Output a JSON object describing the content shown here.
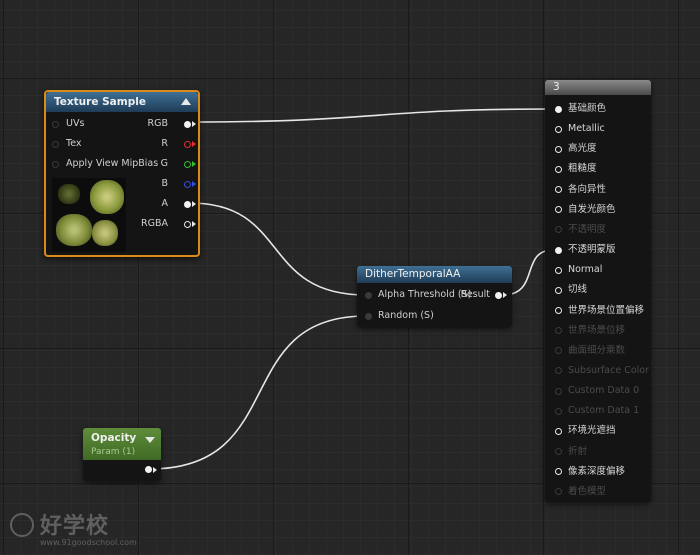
{
  "colors": {
    "node_border_selected": "#d88a1a",
    "pin_red": "#e03030",
    "pin_green": "#30c030",
    "pin_blue": "#3050e0"
  },
  "texture_sample": {
    "title": "Texture Sample",
    "inputs": [
      "UVs",
      "Tex",
      "Apply View MipBias"
    ],
    "outputs": [
      "RGB",
      "R",
      "G",
      "B",
      "A",
      "RGBA"
    ]
  },
  "dither": {
    "title": "DitherTemporalAA",
    "inputs": [
      "Alpha Threshold (S)",
      "Random (S)"
    ],
    "output": "Result"
  },
  "opacity": {
    "title": "Opacity",
    "subtitle": "Param (1)"
  },
  "result": {
    "title": "3",
    "rows": [
      {
        "label": "基础颜色",
        "state": "connected"
      },
      {
        "label": "Metallic",
        "state": "open"
      },
      {
        "label": "高光度",
        "state": "open"
      },
      {
        "label": "粗糙度",
        "state": "open"
      },
      {
        "label": "各向异性",
        "state": "open"
      },
      {
        "label": "自发光颜色",
        "state": "open"
      },
      {
        "label": "不透明度",
        "state": "disabled"
      },
      {
        "label": "不透明蒙版",
        "state": "connected"
      },
      {
        "label": "Normal",
        "state": "open"
      },
      {
        "label": "切线",
        "state": "open"
      },
      {
        "label": "世界场景位置偏移",
        "state": "open"
      },
      {
        "label": "世界场景位移",
        "state": "disabled"
      },
      {
        "label": "曲面细分乘数",
        "state": "disabled"
      },
      {
        "label": "Subsurface Color",
        "state": "disabled"
      },
      {
        "label": "Custom Data 0",
        "state": "disabled"
      },
      {
        "label": "Custom Data 1",
        "state": "disabled"
      },
      {
        "label": "环境光遮挡",
        "state": "open"
      },
      {
        "label": "折射",
        "state": "disabled"
      },
      {
        "label": "像素深度偏移",
        "state": "open"
      },
      {
        "label": "着色模型",
        "state": "disabled"
      }
    ]
  },
  "watermark": {
    "brand": "好学校",
    "site": "www.91goodschool.com"
  }
}
